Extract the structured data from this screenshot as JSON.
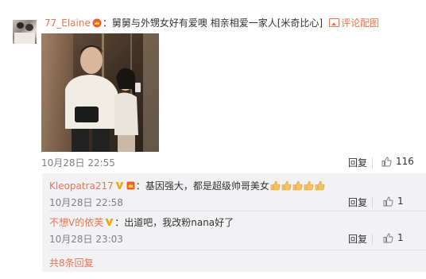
{
  "main_comment": {
    "username": "77_Elaine",
    "colon": "：",
    "text": "舅舅与外甥女好有爱噢 相亲相爱一家人[米奇比心]",
    "pic_action": "评论配图",
    "date": "10月28日 22:55",
    "reply": "回复",
    "likes": "116"
  },
  "replies": [
    {
      "username": "Kleopatra217",
      "colon": "：",
      "text": "基因强大，都是超级帅哥美女",
      "emoji_count": 5,
      "date": "10月28日 22:58",
      "reply": "回复",
      "likes": "1"
    },
    {
      "username": "不想V的依芙",
      "colon": "：",
      "text": "出道吧，我改粉nana好了",
      "date": "10月28日 23:03",
      "reply": "回复",
      "likes": "1"
    }
  ],
  "total_replies": "共8条回复",
  "colors": {
    "accent": "#eb7350",
    "meta": "#808080",
    "sub_bg": "#f2f2f5",
    "v_badge": "#f2a700",
    "emoji": "#f6c45b"
  }
}
